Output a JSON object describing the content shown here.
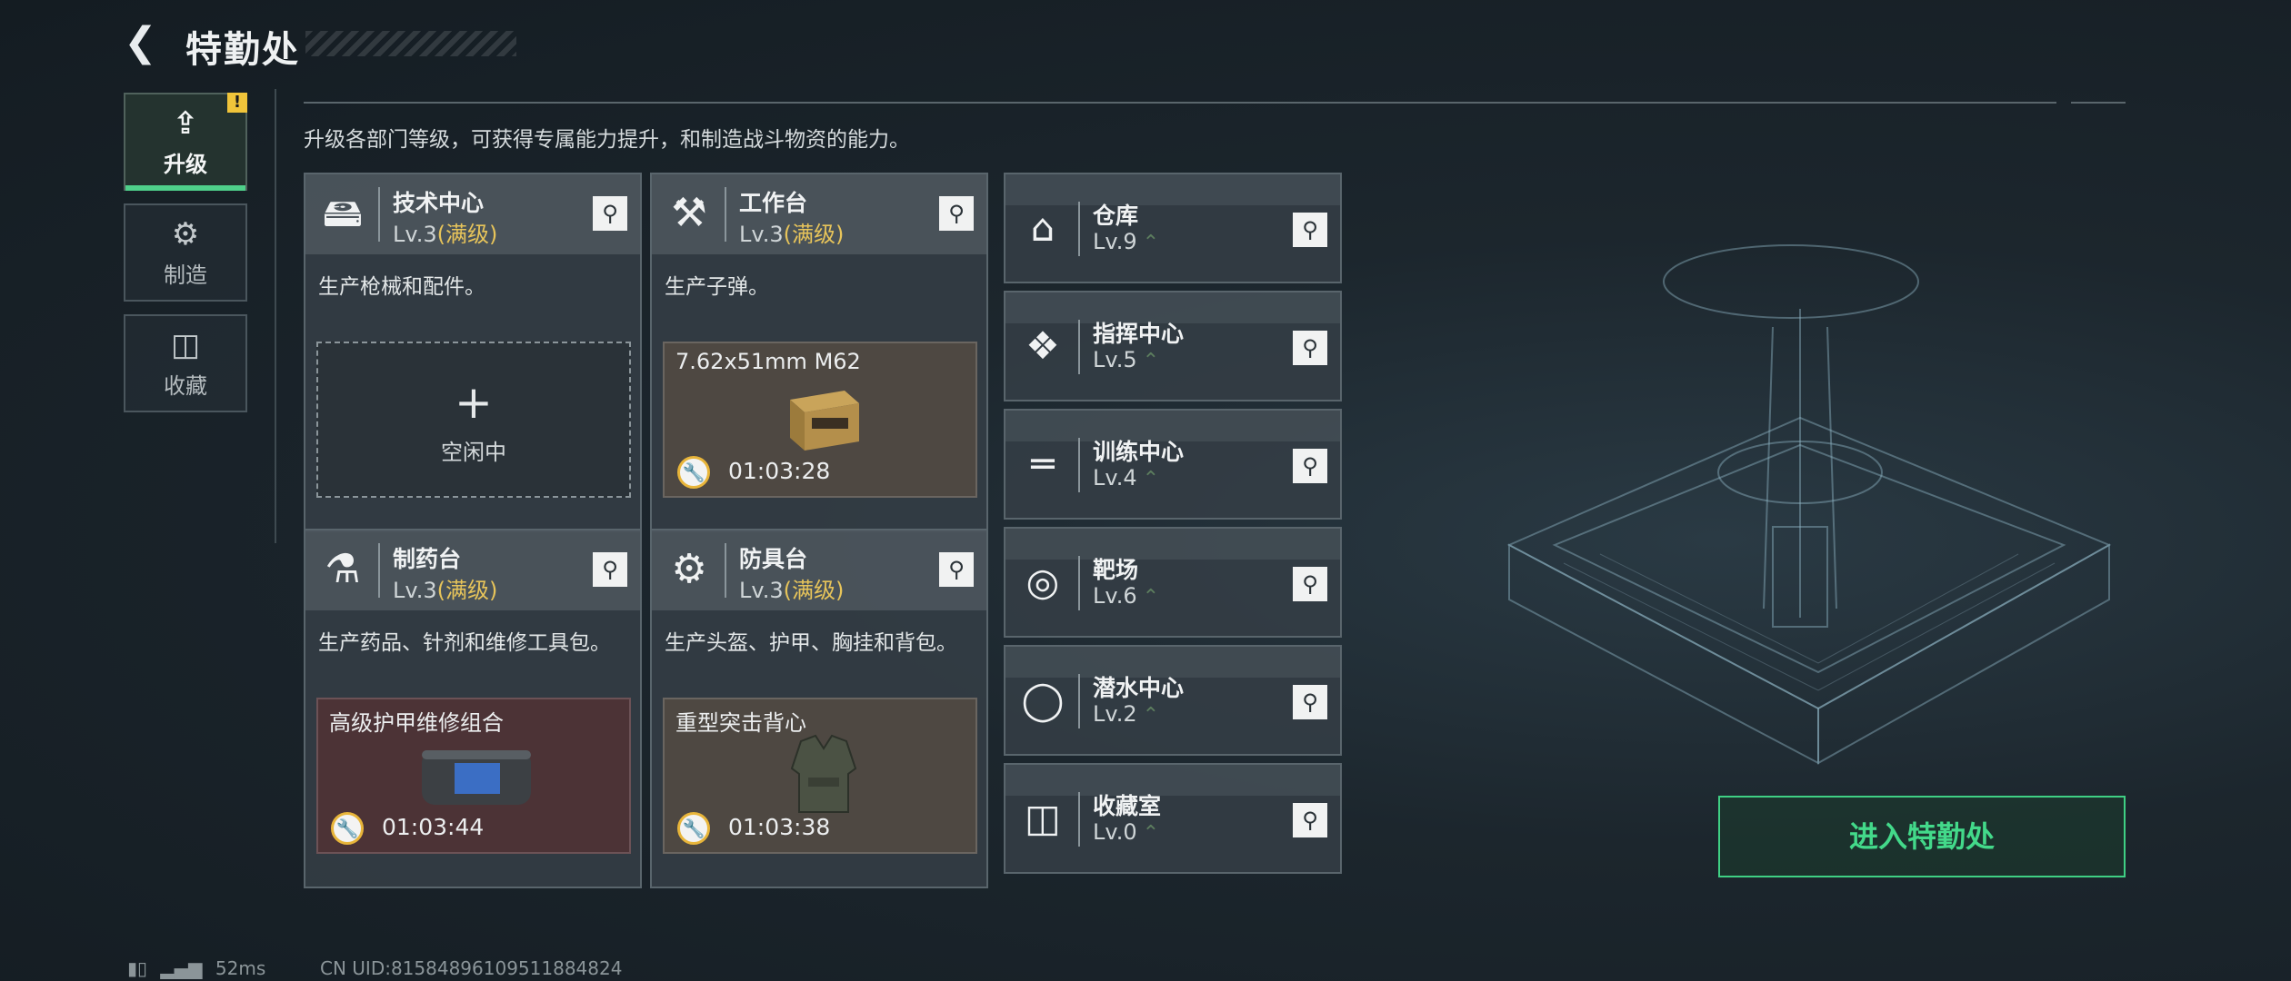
{
  "header": {
    "back_icon": "back-arrow-icon",
    "title": "特勤处"
  },
  "tabs": [
    {
      "label": "升级",
      "icon": "upgrade-icon",
      "active": true,
      "badge": "!"
    },
    {
      "label": "制造",
      "icon": "gears-icon",
      "active": false
    },
    {
      "label": "收藏",
      "icon": "collection-icon",
      "active": false
    }
  ],
  "description": "升级各部门等级，可获得专属能力提升，和制造战斗物资的能力。",
  "departments": [
    {
      "name": "技术中心",
      "level": "Lv.3",
      "max": "(满级)",
      "desc": "生产枪械和配件。",
      "icon": "tech-center-icon",
      "slot": {
        "state": "idle",
        "idle_text": "空闲中"
      }
    },
    {
      "name": "工作台",
      "level": "Lv.3",
      "max": "(满级)",
      "desc": "生产子弹。",
      "icon": "workbench-icon",
      "slot": {
        "state": "producing",
        "item": "7.62x51mm M62",
        "timer": "01:03:28"
      }
    },
    {
      "name": "制药台",
      "level": "Lv.3",
      "max": "(满级)",
      "desc": "生产药品、针剂和维修工具包。",
      "icon": "pharmacy-icon",
      "slot": {
        "state": "producing",
        "item": "高级护甲维修组合",
        "timer": "01:03:44"
      }
    },
    {
      "name": "防具台",
      "level": "Lv.3",
      "max": "(满级)",
      "desc": "生产头盔、护甲、胸挂和背包。",
      "icon": "armor-bench-icon",
      "slot": {
        "state": "producing",
        "item": "重型突击背心",
        "timer": "01:03:38"
      }
    }
  ],
  "facilities": [
    {
      "name": "仓库",
      "level": "Lv.9",
      "icon": "warehouse-icon"
    },
    {
      "name": "指挥中心",
      "level": "Lv.5",
      "icon": "command-center-icon"
    },
    {
      "name": "训练中心",
      "level": "Lv.4",
      "icon": "training-icon"
    },
    {
      "name": "靶场",
      "level": "Lv.6",
      "icon": "target-range-icon"
    },
    {
      "name": "潜水中心",
      "level": "Lv.2",
      "icon": "diving-icon"
    },
    {
      "name": "收藏室",
      "level": "Lv.0",
      "icon": "collection-room-icon"
    }
  ],
  "enter_button": "进入特勤处",
  "status": {
    "ping": "52ms",
    "uid": "CN UID:8158489610951188482­4"
  }
}
